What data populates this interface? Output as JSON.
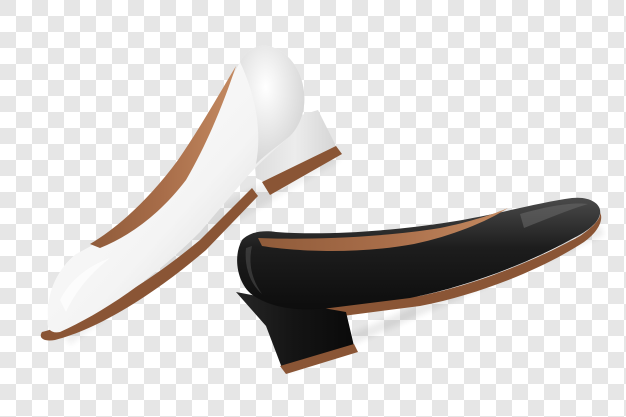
{
  "scene": {
    "background": {
      "pattern": "transparency-checkerboard",
      "light_color": "#ffffff",
      "dark_color": "#e6e6e6"
    },
    "shoes": [
      {
        "name": "white-pump",
        "upper_color": "#f4f4f4",
        "upper_shade_color": "#c9c9c9",
        "lining_color": "#a86d49",
        "sole_color": "#8a5535",
        "heel_color": "#ececec"
      },
      {
        "name": "black-pump",
        "upper_color": "#1d1d1d",
        "upper_highlight_color": "#4a4a4a",
        "lining_color": "#a86d49",
        "sole_color": "#8a5535",
        "heel_color": "#141414"
      }
    ]
  }
}
